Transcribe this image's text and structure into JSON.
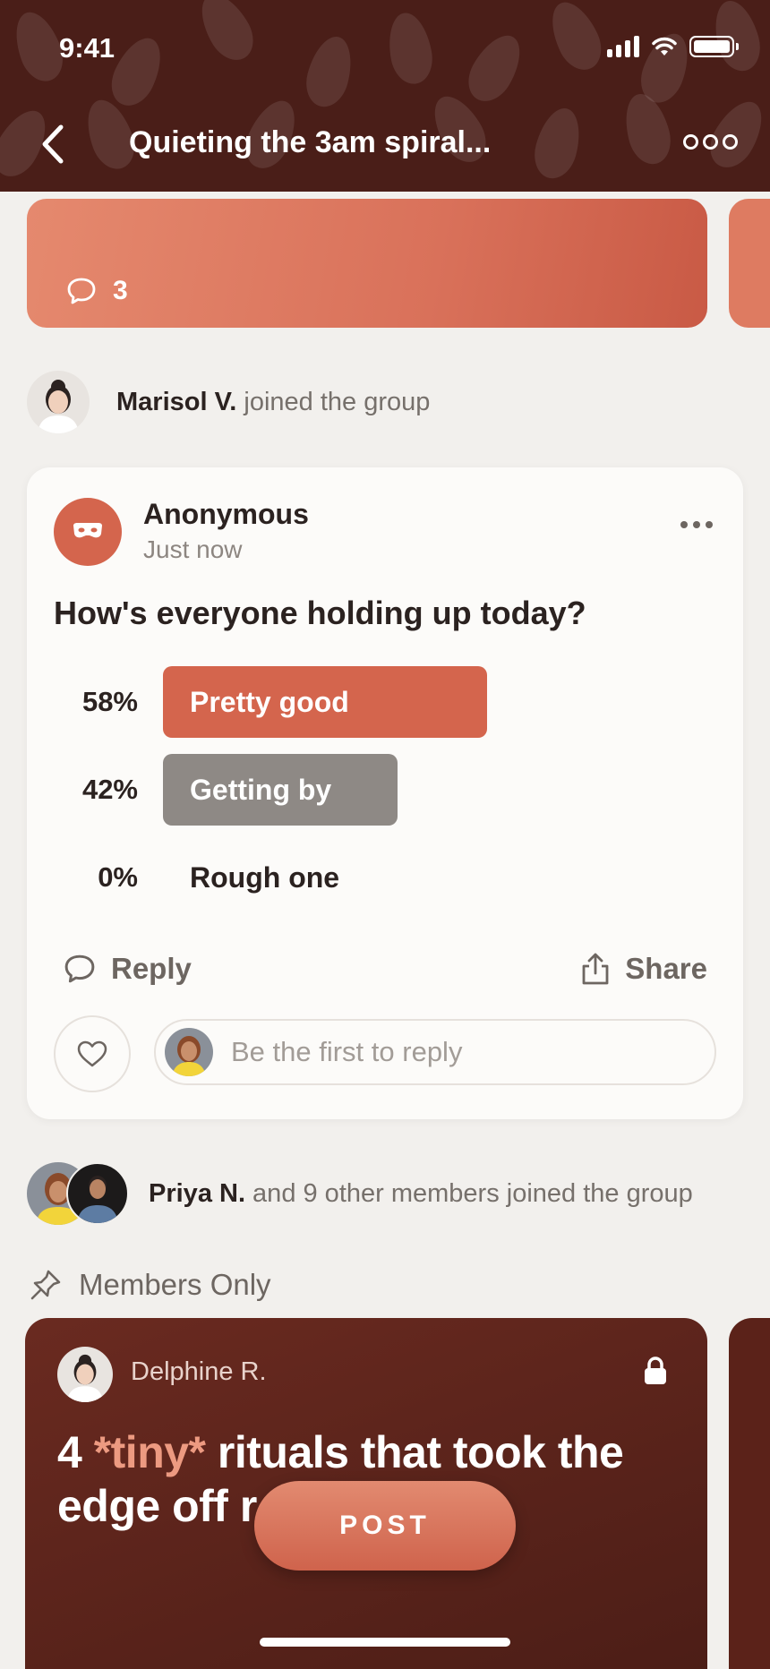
{
  "status_bar": {
    "time": "9:41"
  },
  "header": {
    "title": "Quieting the 3am spiral...",
    "back_icon": "chevron-left-icon",
    "more_icon": "more-circles-icon"
  },
  "banner": {
    "comment_count": "3",
    "icon": "comment-icon"
  },
  "activity_1": {
    "name": "Marisol V.",
    "text": " joined the group"
  },
  "post": {
    "author": "Anonymous",
    "time": "Just now",
    "question": "How's everyone holding up today?",
    "options": [
      {
        "pct": "58%",
        "label": "Pretty good",
        "value": 58,
        "color": "#d4654d"
      },
      {
        "pct": "42%",
        "label": "Getting by",
        "value": 42,
        "color": "#8e8985"
      },
      {
        "pct": "0%",
        "label": "Rough one",
        "value": 0,
        "color": "transparent"
      }
    ],
    "reply_label": "Reply",
    "share_label": "Share",
    "reply_placeholder": "Be the first to reply"
  },
  "activity_2": {
    "name": "Priya N.",
    "text": " and 9 other members joined the group"
  },
  "members_only": {
    "label": "Members Only"
  },
  "featured": {
    "author": "Delphine R.",
    "title_pre": "4 ",
    "title_accent": "*tiny*",
    "title_post": " rituals that took the edge off r"
  },
  "post_button": {
    "label": "POST"
  },
  "colors": {
    "header_bg": "#4a1e18",
    "accent": "#d4654d",
    "page_bg": "#f2f0ed"
  }
}
